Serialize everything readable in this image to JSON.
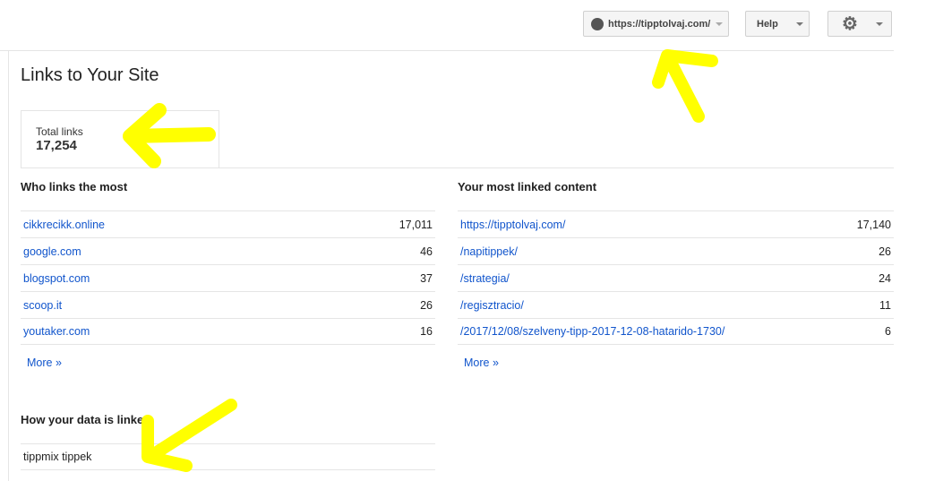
{
  "header": {
    "site": "https://tipptolvaj.com/",
    "help": "Help"
  },
  "page_title": "Links to Your Site",
  "total": {
    "label": "Total links",
    "value": "17,254"
  },
  "who_links": {
    "title": "Who links the most",
    "rows": [
      {
        "name": "cikkrecikk.online",
        "count": "17,011"
      },
      {
        "name": "google.com",
        "count": "46"
      },
      {
        "name": "blogspot.com",
        "count": "37"
      },
      {
        "name": "scoop.it",
        "count": "26"
      },
      {
        "name": "youtaker.com",
        "count": "16"
      }
    ],
    "more": "More »"
  },
  "most_linked": {
    "title": "Your most linked content",
    "rows": [
      {
        "name": "https://tipptolvaj.com/",
        "count": "17,140"
      },
      {
        "name": "/napitippek/",
        "count": "26"
      },
      {
        "name": "/strategia/",
        "count": "24"
      },
      {
        "name": "/regisztracio/",
        "count": "11"
      },
      {
        "name": "/2017/12/08/szelveny-tipp-2017-12-08-hatarido-1730/",
        "count": "6"
      }
    ],
    "more": "More »"
  },
  "data_linked": {
    "title": "How your data is linked",
    "rows": [
      {
        "name": "tippmix tippek"
      }
    ]
  },
  "colors": {
    "link": "#1155cc",
    "annotation": "#ffff00"
  }
}
